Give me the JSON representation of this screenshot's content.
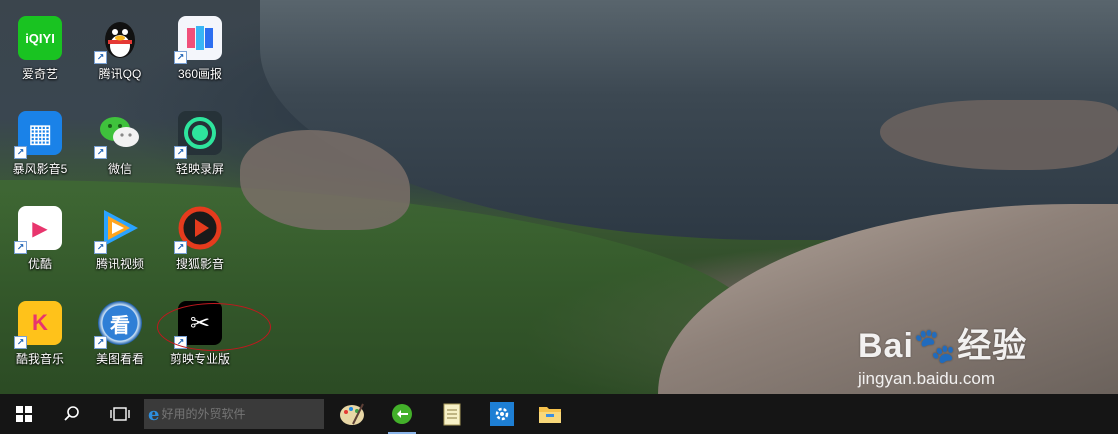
{
  "desktop": {
    "icons": [
      {
        "label": "爱奇艺",
        "glyph": "iQIYI",
        "color": "#19c321"
      },
      {
        "label": "腾讯QQ",
        "glyph": "QQ",
        "color": "#1b1b1b"
      },
      {
        "label": "360画报",
        "glyph": "▮▮",
        "color": "#2f8cf0"
      },
      {
        "label": "暴风影音5",
        "glyph": "▦",
        "color": "#1a82e8"
      },
      {
        "label": "微信",
        "glyph": "◎",
        "color": "#39c43a"
      },
      {
        "label": "轻映录屏",
        "glyph": "◉",
        "color": "#222a2e"
      },
      {
        "label": "优酷",
        "glyph": "▶",
        "color": "#ffffff"
      },
      {
        "label": "腾讯视频",
        "glyph": "▶",
        "color": "#1e88e5"
      },
      {
        "label": "搜狐影音",
        "glyph": "▶",
        "color": "#e64a19"
      },
      {
        "label": "酷我音乐",
        "glyph": "K",
        "color": "#ffc21a"
      },
      {
        "label": "美图看看",
        "glyph": "看",
        "color": "#1f6fc6"
      },
      {
        "label": "剪映专业版",
        "glyph": "✂",
        "color": "#000000"
      }
    ]
  },
  "taskbar": {
    "search_placeholder": "好用的外贸软件",
    "pinned": [
      "paint-icon",
      "app-green-icon",
      "notepad-icon",
      "settings-icon",
      "file-explorer-icon"
    ]
  },
  "watermark": {
    "logo": "Bai🐾经验",
    "url": "jingyan.baidu.com"
  }
}
